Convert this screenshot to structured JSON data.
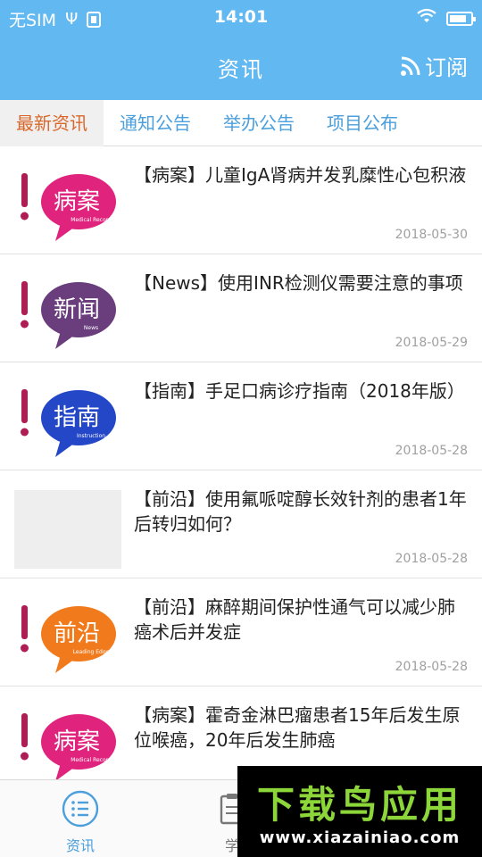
{
  "status_bar": {
    "carrier": "无SIM",
    "time": "14:01"
  },
  "header": {
    "title": "资讯",
    "subscribe_label": "订阅"
  },
  "tabs": [
    {
      "label": "最新资讯",
      "active": true
    },
    {
      "label": "通知公告",
      "active": false
    },
    {
      "label": "举办公告",
      "active": false
    },
    {
      "label": "项目公布",
      "active": false
    }
  ],
  "news": [
    {
      "title": "【病案】儿童IgA肾病并发乳糜性心包积液",
      "date": "2018-05-30",
      "badge": {
        "text": "病案",
        "sub": "Medical Record",
        "color": "#e0247e"
      }
    },
    {
      "title": "【News】使用INR检测仪需要注意的事项",
      "date": "2018-05-29",
      "badge": {
        "text": "新闻",
        "sub": "News",
        "color": "#6a3d7c"
      }
    },
    {
      "title": "【指南】手足口病诊疗指南（2018年版）",
      "date": "2018-05-28",
      "badge": {
        "text": "指南",
        "sub": "Instruction",
        "color": "#2447c8"
      }
    },
    {
      "title": "【前沿】使用氟哌啶醇长效针剂的患者1年后转归如何？",
      "date": "2018-05-28",
      "badge": null
    },
    {
      "title": "【前沿】麻醉期间保护性通气可以减少肺癌术后并发症",
      "date": "2018-05-28",
      "badge": {
        "text": "前沿",
        "sub": "Leading Edge",
        "color": "#f07a1c"
      }
    },
    {
      "title": "【病案】霍奇金淋巴瘤患者15年后发生原位喉癌，20年后发生肺癌",
      "date": "",
      "badge": {
        "text": "病案",
        "sub": "Medical Record",
        "color": "#e0247e"
      }
    }
  ],
  "bottom_nav": [
    {
      "label": "资讯",
      "icon": "list-icon",
      "active": true
    },
    {
      "label": "学",
      "icon": "clipboard-icon",
      "active": false
    }
  ],
  "watermark": {
    "title": "下载鸟应用",
    "url": "www.xiazainiao.com"
  },
  "colors": {
    "header_bg": "#62b8f0",
    "tab_active": "#d9672a",
    "tab_inactive": "#4a9fdc",
    "exclamation": "#b01d55"
  }
}
